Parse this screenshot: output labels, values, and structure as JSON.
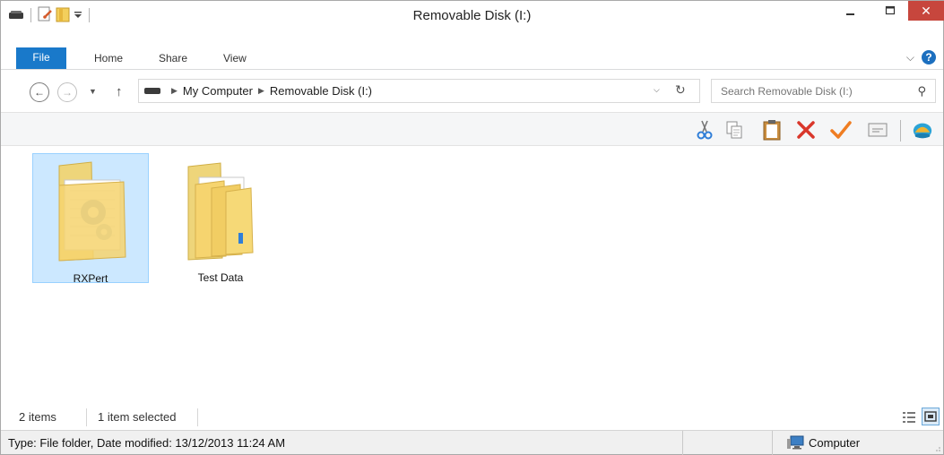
{
  "window": {
    "title": "Removable Disk (I:)",
    "close_glyph": "✕"
  },
  "ribbon": {
    "tabs": [
      {
        "label": "File",
        "active": true
      },
      {
        "label": "Home"
      },
      {
        "label": "Share"
      },
      {
        "label": "View"
      }
    ],
    "expand_glyph": "⌵",
    "help_glyph": "?"
  },
  "nav": {
    "back_glyph": "←",
    "forward_glyph": "→",
    "recent_glyph": "▼",
    "up_glyph": "↑",
    "breadcrumb": [
      "My Computer",
      "Removable Disk (I:)"
    ],
    "crumb_arrow_glyph": "▶",
    "dropdown_glyph": "⌵",
    "refresh_glyph": "↻",
    "search_placeholder": "Search Removable Disk (I:)",
    "search_glyph": "⚲"
  },
  "toolbar": {
    "icons": [
      "scissors-icon",
      "copy-icon",
      "paste-icon",
      "delete-icon",
      "checkmark-icon",
      "properties-icon",
      "shell-icon"
    ]
  },
  "items": [
    {
      "label": "RXPert",
      "selected": true,
      "icon": "folder-with-document-icon"
    },
    {
      "label": "Test Data",
      "selected": false,
      "icon": "folder-with-files-icon"
    }
  ],
  "status": {
    "count": "2 items",
    "selection": "1 item selected"
  },
  "details": {
    "text": "Type: File folder, Date modified: 13/12/2013 11:24 AM",
    "location": "Computer"
  },
  "colors": {
    "accent": "#1979ca",
    "selection": "#cce8ff",
    "selection_border": "#99d1ff",
    "close": "#c7463d"
  }
}
